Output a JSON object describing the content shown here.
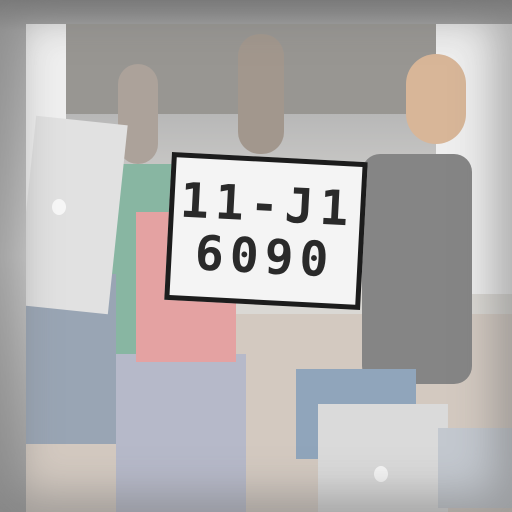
{
  "plate": {
    "line1": "11-J1",
    "line2": "6090"
  }
}
